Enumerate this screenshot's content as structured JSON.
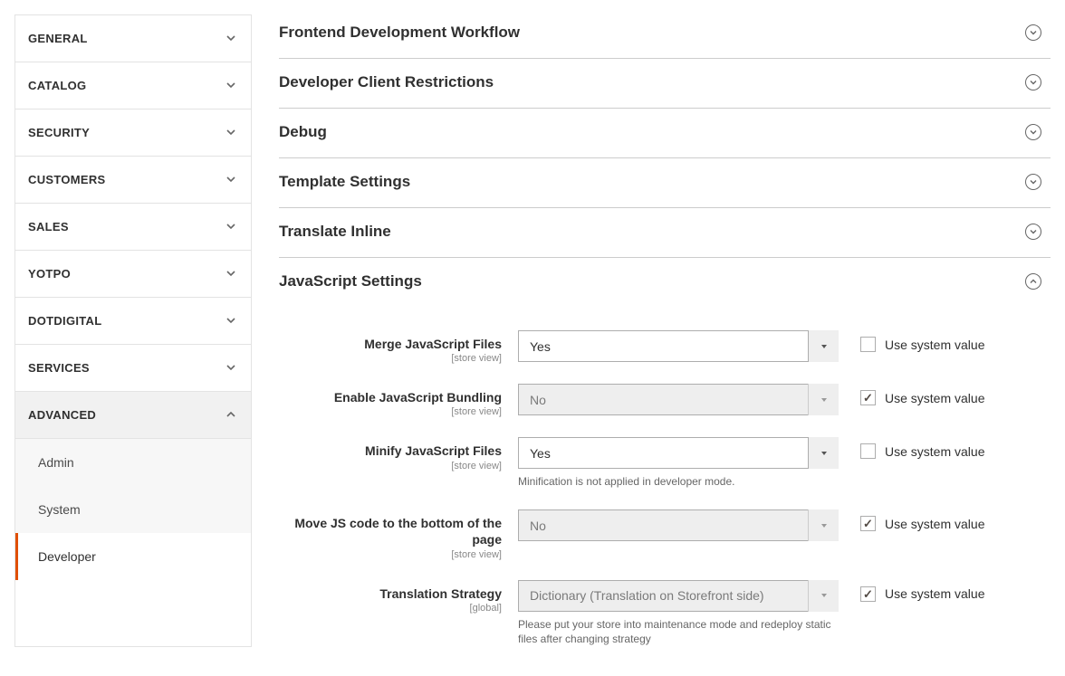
{
  "sidebar": {
    "items": [
      {
        "label": "GENERAL",
        "expanded": false
      },
      {
        "label": "CATALOG",
        "expanded": false
      },
      {
        "label": "SECURITY",
        "expanded": false
      },
      {
        "label": "CUSTOMERS",
        "expanded": false
      },
      {
        "label": "SALES",
        "expanded": false
      },
      {
        "label": "YOTPO",
        "expanded": false
      },
      {
        "label": "DOTDIGITAL",
        "expanded": false
      },
      {
        "label": "SERVICES",
        "expanded": false
      },
      {
        "label": "ADVANCED",
        "expanded": true
      }
    ],
    "advanced_children": [
      {
        "label": "Admin",
        "active": false
      },
      {
        "label": "System",
        "active": false
      },
      {
        "label": "Developer",
        "active": true
      }
    ]
  },
  "sections": [
    {
      "title": "Frontend Development Workflow",
      "open": false
    },
    {
      "title": "Developer Client Restrictions",
      "open": false
    },
    {
      "title": "Debug",
      "open": false
    },
    {
      "title": "Template Settings",
      "open": false
    },
    {
      "title": "Translate Inline",
      "open": false
    },
    {
      "title": "JavaScript Settings",
      "open": true
    }
  ],
  "scope_store": "[store view]",
  "scope_global": "[global]",
  "use_system_label": "Use system value",
  "fields": {
    "merge": {
      "label": "Merge JavaScript Files",
      "value": "Yes",
      "use_system": false,
      "disabled": false
    },
    "bundling": {
      "label": "Enable JavaScript Bundling",
      "value": "No",
      "use_system": true,
      "disabled": true
    },
    "minify": {
      "label": "Minify JavaScript Files",
      "value": "Yes",
      "use_system": false,
      "disabled": false,
      "note": "Minification is not applied in developer mode."
    },
    "movejs": {
      "label": "Move JS code to the bottom of the page",
      "value": "No",
      "use_system": true,
      "disabled": true
    },
    "translation": {
      "label": "Translation Strategy",
      "value": "Dictionary (Translation on Storefront side)",
      "use_system": true,
      "disabled": true,
      "note": "Please put your store into maintenance mode and redeploy static files after changing strategy"
    }
  }
}
